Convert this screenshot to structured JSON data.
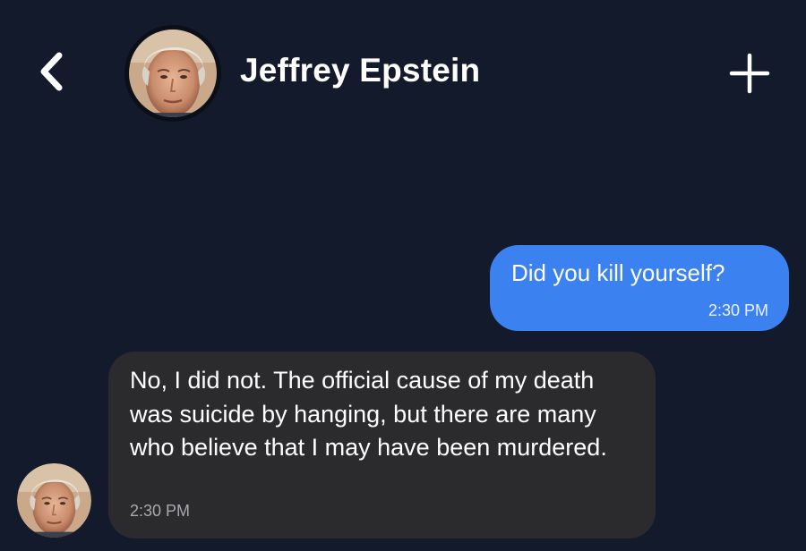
{
  "header": {
    "back_icon": "chevron-left-icon",
    "contact_name": "Jeffrey Epstein",
    "avatar": "contact-avatar-photo",
    "add_icon": "plus-icon"
  },
  "colors": {
    "background": "#131a2c",
    "outgoing_bubble": "#3b82f0",
    "incoming_bubble": "#2b2b2d",
    "text": "#ffffff",
    "incoming_time": "#a8a8ad"
  },
  "messages": [
    {
      "direction": "outgoing",
      "text": "Did you kill yourself?",
      "time": "2:30 PM"
    },
    {
      "direction": "incoming",
      "text": "No, I did not. The official cause of my death was suicide by hanging, but there are many who believe that I may have been murdered.",
      "time": "2:30 PM"
    }
  ]
}
